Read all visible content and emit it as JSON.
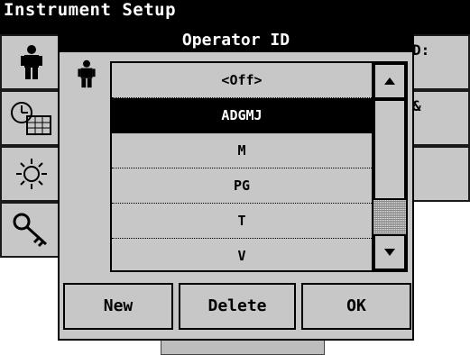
{
  "window": {
    "title": "Instrument Setup"
  },
  "background": {
    "right_labels": [
      "D:",
      "&"
    ]
  },
  "dialog": {
    "title": "Operator ID",
    "list_items": [
      {
        "label": "<Off>",
        "selected": false
      },
      {
        "label": "ADGMJ",
        "selected": true
      },
      {
        "label": "M",
        "selected": false
      },
      {
        "label": "PG",
        "selected": false
      },
      {
        "label": "T",
        "selected": false
      },
      {
        "label": "V",
        "selected": false
      }
    ],
    "buttons": {
      "new": "New",
      "delete": "Delete",
      "ok": "OK"
    }
  },
  "icons": {
    "operator": "person-icon",
    "clock_calendar": "clock-calendar-icon",
    "lamp": "lamp-icon",
    "key": "key-icon",
    "scroll_up": "arrow-up-icon",
    "scroll_down": "arrow-down-icon"
  },
  "colors": {
    "panel": "#c7c7c7",
    "selection": "#000000",
    "selection_text": "#ffffff"
  }
}
